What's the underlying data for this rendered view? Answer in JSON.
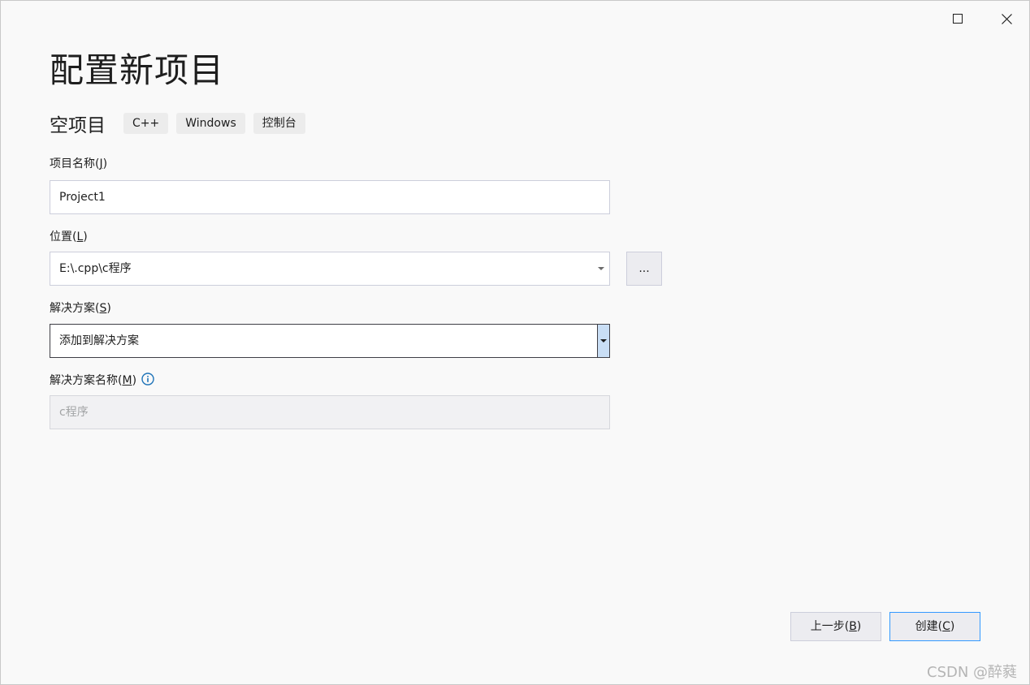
{
  "window": {
    "maximize_icon": "maximize-icon",
    "close_icon": "close-icon"
  },
  "title": "配置新项目",
  "template": {
    "name": "空项目",
    "tags": [
      "C++",
      "Windows",
      "控制台"
    ]
  },
  "project_name": {
    "label": "项目名称",
    "hotkey": "J",
    "value": "Project1"
  },
  "location": {
    "label": "位置",
    "hotkey": "L",
    "value": "E:\\.cpp\\c程序",
    "browse_label": "..."
  },
  "solution": {
    "label": "解决方案",
    "hotkey": "S",
    "value": "添加到解决方案"
  },
  "solution_name": {
    "label": "解决方案名称",
    "hotkey": "M",
    "value": "c程序",
    "info_icon": "info-icon"
  },
  "buttons": {
    "back_label": "上一步",
    "back_hotkey": "B",
    "create_label": "创建",
    "create_hotkey": "C"
  },
  "watermark": "CSDN @醉蕤",
  "colors": {
    "background": "#f9f9f9",
    "accent_border": "#3399ff",
    "info_blue": "#1e73b8",
    "dropdown_button": "#c9def5"
  }
}
